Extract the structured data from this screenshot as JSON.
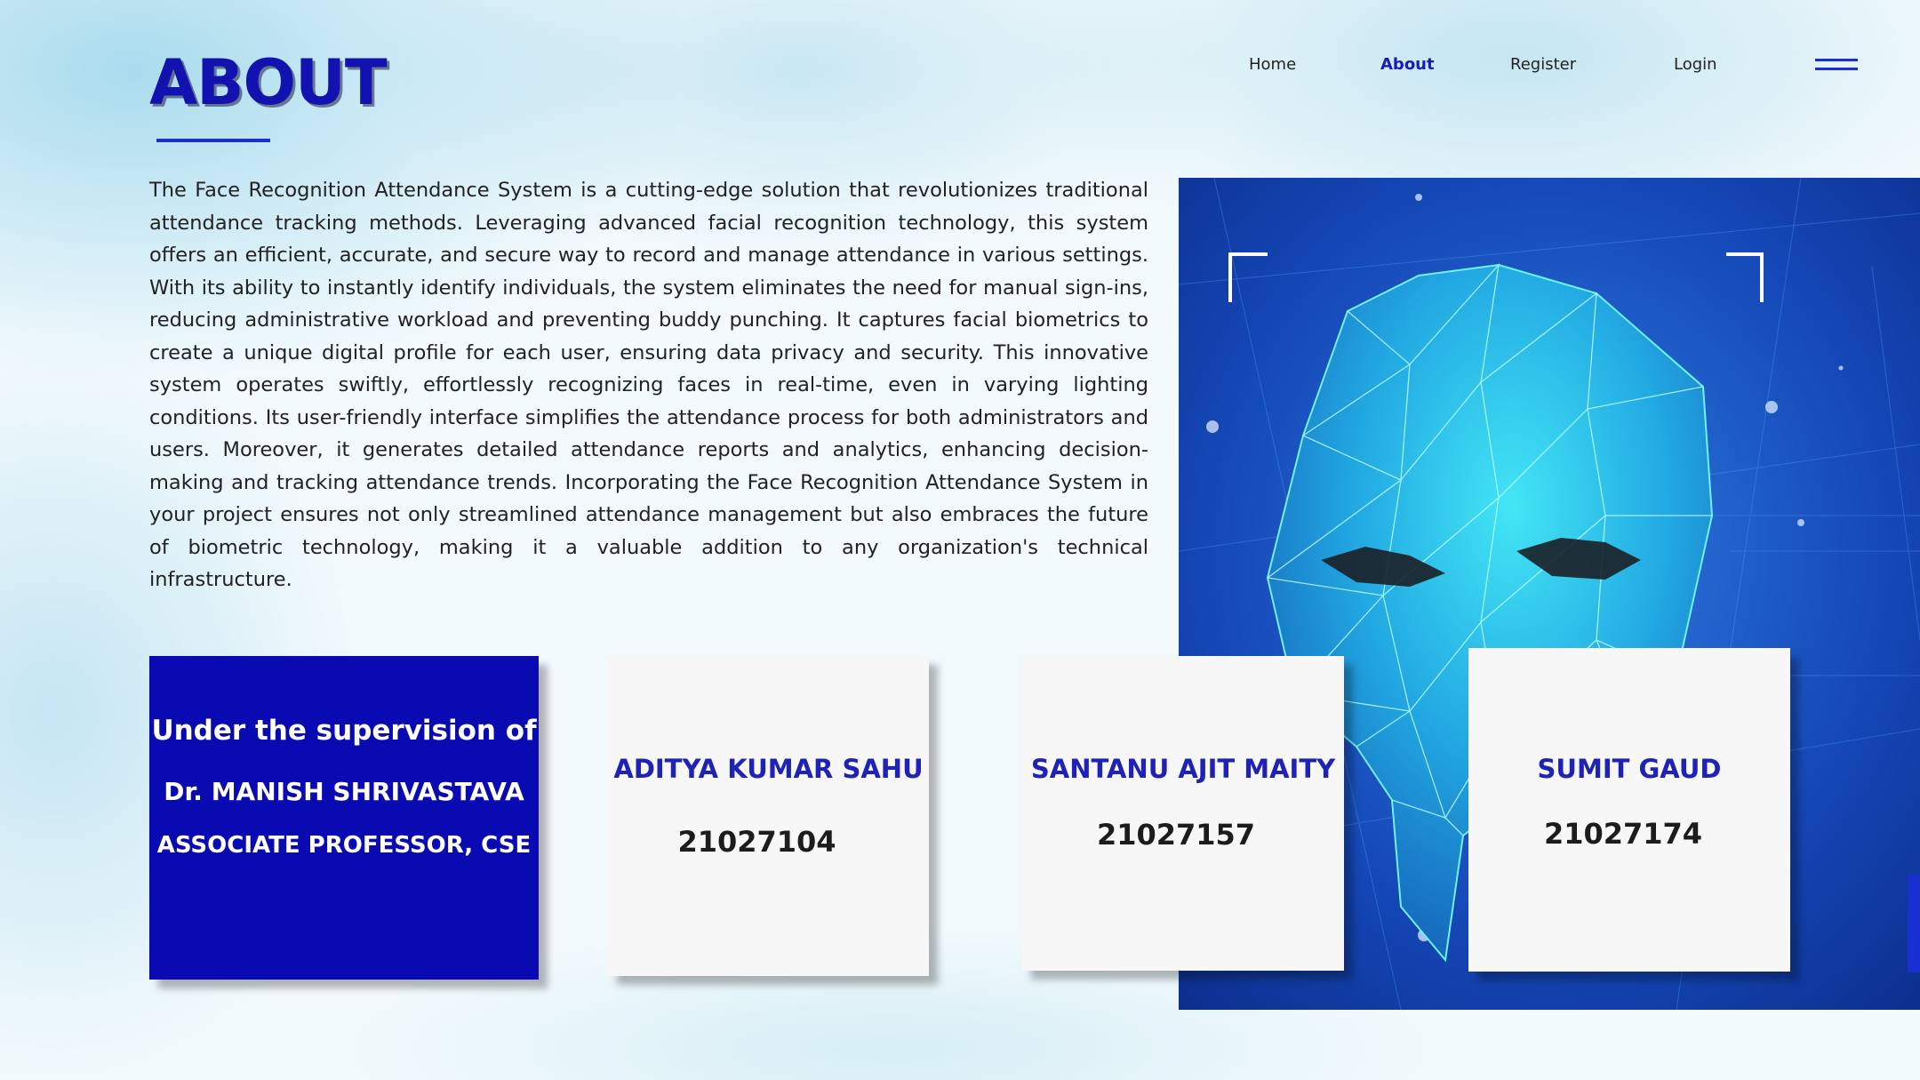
{
  "page": {
    "title": "ABOUT"
  },
  "nav": {
    "items": [
      {
        "label": "Home",
        "active": false
      },
      {
        "label": "About",
        "active": true
      },
      {
        "label": "Register",
        "active": false
      },
      {
        "label": "Login",
        "active": false
      }
    ],
    "menu_icon": "hamburger-menu-icon"
  },
  "about": {
    "paragraph": "The Face Recognition Attendance System is a cutting-edge solution that revolutionizes traditional attendance tracking methods. Leveraging advanced facial recognition technology, this system offers an efficient, accurate, and secure way to record and manage attendance in various settings. With its ability to instantly identify individuals, the system eliminates the need for manual sign-ins, reducing administrative workload and preventing buddy punching. It captures facial biometrics to create a unique digital profile for each user, ensuring data privacy and security. This innovative system operates swiftly, effortlessly recognizing faces in real-time, even in varying lighting conditions. Its user-friendly interface simplifies the attendance process for both administrators and users. Moreover, it generates detailed attendance reports and analytics, enhancing decision-making and tracking attendance trends. Incorporating the Face Recognition Attendance System in your project ensures not only streamlined attendance management but also embraces the future of biometric technology, making it a valuable addition to any organization's technical infrastructure."
  },
  "hero_image": {
    "icon": "polygonal-face-scan-illustration"
  },
  "supervisor": {
    "heading": "Under the supervision of",
    "name": "Dr. MANISH SHRIVASTAVA",
    "designation": "ASSOCIATE PROFESSOR, CSE"
  },
  "team": [
    {
      "name": "ADITYA KUMAR SAHU",
      "roll": "21027104"
    },
    {
      "name": "SANTANU AJIT MAITY",
      "roll": "21027157"
    },
    {
      "name": "SUMIT GAUD",
      "roll": "21027174"
    }
  ],
  "colors": {
    "accent": "#1a1ab8",
    "supervisor_card": "#0a0ab2",
    "student_card": "#f7f7f7",
    "hero_background": "#1340a8"
  }
}
